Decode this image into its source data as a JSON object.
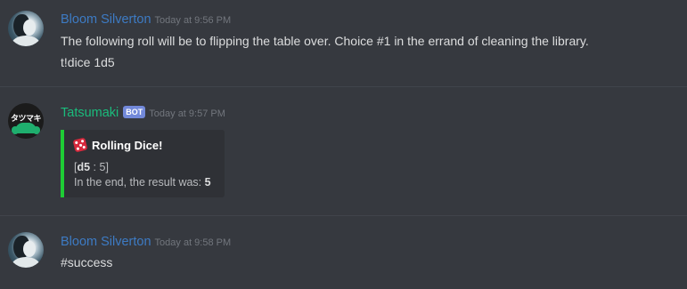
{
  "messages": [
    {
      "username": "Bloom Silverton",
      "timestamp": "Today at 9:56 PM",
      "lines": [
        "The following roll will be to flipping the table over. Choice #1 in the errand of cleaning the library.",
        "t!dice 1d5"
      ]
    },
    {
      "username": "Tatsumaki",
      "bot_tag": "BOT",
      "timestamp": "Today at 9:57 PM",
      "avatar_text": "タツマキ",
      "embed": {
        "accent_color": "#1fcc35",
        "icon": "game-die-icon",
        "title": "Rolling Dice!",
        "open_bracket": "[",
        "die": "d5",
        "separator": " : ",
        "roll": "5",
        "close_bracket": "]",
        "result_prefix": "In the end, the result was: ",
        "result_value": "5"
      }
    },
    {
      "username": "Bloom Silverton",
      "timestamp": "Today at 9:58 PM",
      "lines": [
        "#success"
      ]
    }
  ],
  "colors": {
    "background": "#36393f",
    "username_bloom": "#3d7bc4",
    "username_tatsumaki": "#1abc7c",
    "bot_tag": "#7289da"
  }
}
